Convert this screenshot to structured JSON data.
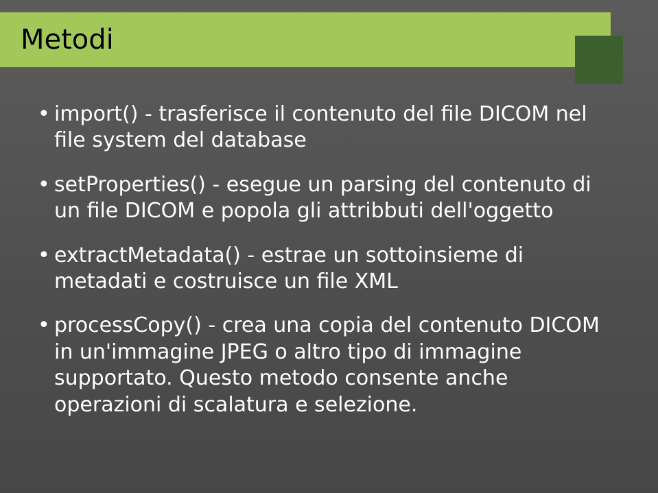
{
  "slide": {
    "title": "Metodi",
    "bullets": [
      "import() - trasferisce il contenuto del file DICOM nel file system del database",
      "setProperties() - esegue un parsing del contenuto di un file DICOM e popola gli attribbuti dell'oggetto",
      "extractMetadata() - estrae un sottoinsieme di metadati e costruisce un file XML",
      "processCopy() - crea una copia del contenuto DICOM in un'immagine JPEG o altro tipo di immagine supportato. Questo metodo consente anche operazioni di scalatura e selezione."
    ]
  }
}
